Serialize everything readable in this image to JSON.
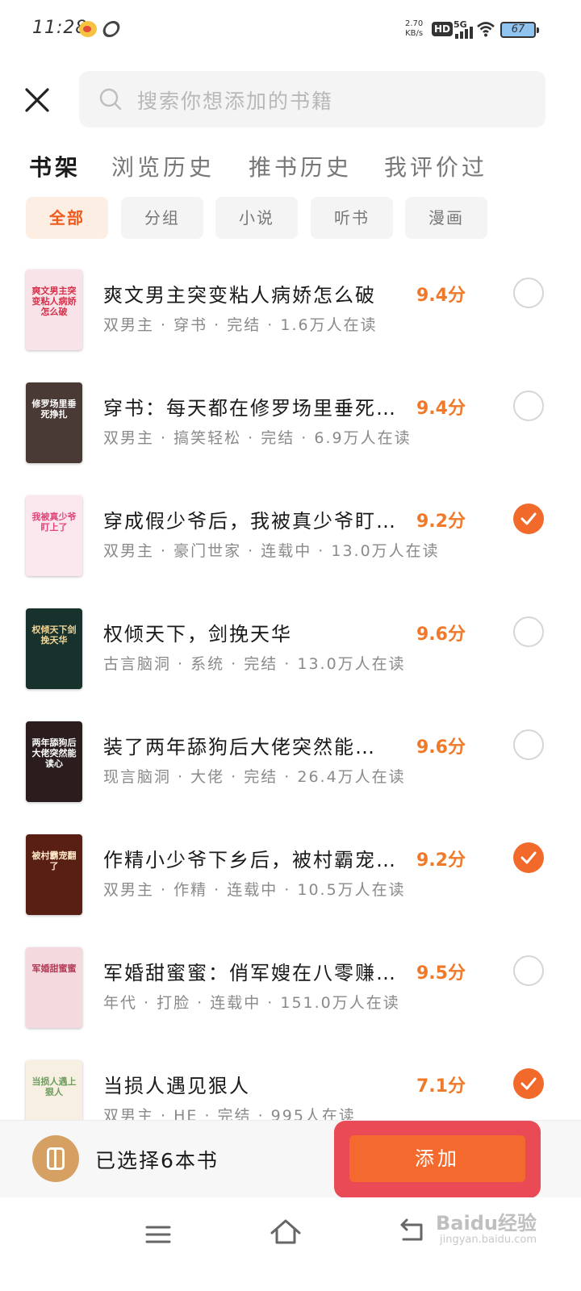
{
  "status_bar": {
    "time": "11:28",
    "net_speed_value": "2.70",
    "net_speed_unit": "KB/s",
    "hd": "HD",
    "network": "5G",
    "battery": "67"
  },
  "search": {
    "placeholder": "搜索你想添加的书籍"
  },
  "tabs": [
    {
      "label": "书架",
      "active": true
    },
    {
      "label": "浏览历史",
      "active": false
    },
    {
      "label": "推书历史",
      "active": false
    },
    {
      "label": "我评价过",
      "active": false
    }
  ],
  "filters": [
    {
      "label": "全部",
      "active": true
    },
    {
      "label": "分组",
      "active": false
    },
    {
      "label": "小说",
      "active": false
    },
    {
      "label": "听书",
      "active": false
    },
    {
      "label": "漫画",
      "active": false
    }
  ],
  "books": [
    {
      "title": "爽文男主突变粘人病娇怎么破",
      "meta": "双男主 · 穿书 · 完结 · 1.6万人在读",
      "score": "9.4分",
      "checked": false
    },
    {
      "title": "穿书：每天都在修罗场里垂死…",
      "meta": "双男主 · 搞笑轻松 · 完结 · 6.9万人在读",
      "score": "9.4分",
      "checked": false
    },
    {
      "title": "穿成假少爷后，我被真少爷盯…",
      "meta": "双男主 · 豪门世家 · 连载中 · 13.0万人在读",
      "score": "9.2分",
      "checked": true
    },
    {
      "title": "权倾天下，剑挽天华",
      "meta": "古言脑洞 · 系统 · 完结 · 13.0万人在读",
      "score": "9.6分",
      "checked": false
    },
    {
      "title": "装了两年舔狗后大佬突然能…",
      "meta": "现言脑洞 · 大佬 · 完结 · 26.4万人在读",
      "score": "9.6分",
      "checked": false
    },
    {
      "title": "作精小少爷下乡后，被村霸宠…",
      "meta": "双男主 · 作精 · 连载中 · 10.5万人在读",
      "score": "9.2分",
      "checked": true
    },
    {
      "title": "军婚甜蜜蜜：俏军嫂在八零赚…",
      "meta": "年代 · 打脸 · 连载中 · 151.0万人在读",
      "score": "9.5分",
      "checked": false
    },
    {
      "title": "当损人遇见狠人",
      "meta": "双男主 · HE · 完结 · 995人在读",
      "score": "7.1分",
      "checked": true
    }
  ],
  "covers": [
    {
      "bg": "#f7e3e8",
      "fg": "#d8304a",
      "text": "爽文男主突变粘人病娇怎么破"
    },
    {
      "bg": "#4a3a36",
      "fg": "#ffffff",
      "text": "修罗场里垂死挣扎"
    },
    {
      "bg": "#fbe8ef",
      "fg": "#e0447a",
      "text": "我被真少爷盯上了"
    },
    {
      "bg": "#17322c",
      "fg": "#f3d79a",
      "text": "权倾天下剑挽天华"
    },
    {
      "bg": "#2b1d1d",
      "fg": "#ffffff",
      "text": "两年舔狗后大佬突然能读心"
    },
    {
      "bg": "#5a1f14",
      "fg": "#ffe9c8",
      "text": "被村霸宠翻了"
    },
    {
      "bg": "#f4d9de",
      "fg": "#b23b55",
      "text": "军婚甜蜜蜜"
    },
    {
      "bg": "#f6efe2",
      "fg": "#6f9d5e",
      "text": "当损人遇上狠人"
    }
  ],
  "footer": {
    "selected_text": "已选择6本书",
    "add_label": "添加"
  },
  "watermark": {
    "text": "Baidu经验",
    "sub": "jingyan.baidu.com"
  },
  "colors": {
    "accent": "#f26a2b",
    "highlight_frame": "#e94a55",
    "score": "#f07a2a"
  }
}
